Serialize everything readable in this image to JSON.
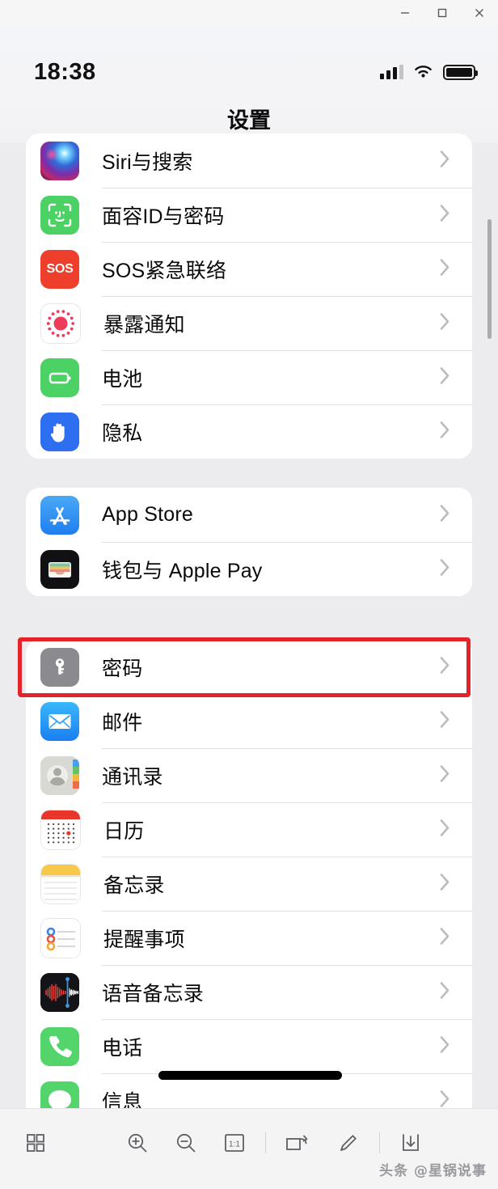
{
  "window": {
    "minimize_label": "minimize",
    "maximize_label": "maximize",
    "close_label": "close"
  },
  "status_bar": {
    "time": "18:38",
    "signal_icon": "cellular-signal-icon",
    "signal_bars_filled": 3,
    "signal_bars_total": 4,
    "wifi_icon": "wifi-icon",
    "battery_icon": "battery-icon",
    "battery_level": "full"
  },
  "nav": {
    "title": "设置"
  },
  "groups": [
    {
      "id": "group-system",
      "rows": [
        {
          "label": "Siri与搜索",
          "icon": "siri-icon",
          "icon_class": "ic-siri"
        },
        {
          "label": "面容ID与密码",
          "icon": "face-id-icon",
          "icon_class": "ic-faceid"
        },
        {
          "label": "SOS紧急联络",
          "icon": "sos-icon",
          "icon_class": "ic-sos"
        },
        {
          "label": "暴露通知",
          "icon": "exposure-notification-icon",
          "icon_class": "ic-exposure"
        },
        {
          "label": "电池",
          "icon": "battery-settings-icon",
          "icon_class": "ic-battery"
        },
        {
          "label": "隐私",
          "icon": "privacy-hand-icon",
          "icon_class": "ic-privacy"
        }
      ]
    },
    {
      "id": "group-store",
      "rows": [
        {
          "label": "App Store",
          "icon": "app-store-icon",
          "icon_class": "ic-appstore"
        },
        {
          "label": "钱包与 Apple Pay",
          "icon": "wallet-icon",
          "icon_class": "ic-wallet"
        }
      ]
    },
    {
      "id": "group-apps",
      "rows": [
        {
          "label": "密码",
          "icon": "passwords-key-icon",
          "icon_class": "ic-pass"
        },
        {
          "label": "邮件",
          "icon": "mail-icon",
          "icon_class": "ic-mail"
        },
        {
          "label": "通讯录",
          "icon": "contacts-icon",
          "icon_class": "ic-contacts"
        },
        {
          "label": "日历",
          "icon": "calendar-icon",
          "icon_class": "ic-calendar"
        },
        {
          "label": "备忘录",
          "icon": "notes-icon",
          "icon_class": "ic-notes"
        },
        {
          "label": "提醒事项",
          "icon": "reminders-icon",
          "icon_class": "ic-reminders"
        },
        {
          "label": "语音备忘录",
          "icon": "voice-memos-icon",
          "icon_class": "ic-voice"
        },
        {
          "label": "电话",
          "icon": "phone-icon",
          "icon_class": "ic-phone"
        },
        {
          "label": "信息",
          "icon": "messages-icon",
          "icon_class": "ic-messages"
        }
      ]
    }
  ],
  "annotation": {
    "highlight_color": "#e4232a",
    "highlight_target": "密码",
    "redaction_color": "#000000",
    "redaction_target": "信息"
  },
  "toolbar": {
    "items": [
      {
        "name": "thumbnails-grid-icon",
        "title": "缩略图"
      },
      {
        "name": "zoom-in-icon",
        "title": "放大"
      },
      {
        "name": "zoom-out-icon",
        "title": "缩小"
      },
      {
        "name": "actual-size-icon",
        "title": "1:1"
      },
      {
        "name": "rotate-icon",
        "title": "旋转"
      },
      {
        "name": "edit-pencil-icon",
        "title": "编辑"
      },
      {
        "name": "save-download-icon",
        "title": "保存"
      }
    ],
    "watermark": "头条 @星锅说事"
  },
  "scrollbar": {
    "name": "vertical-scrollbar"
  }
}
